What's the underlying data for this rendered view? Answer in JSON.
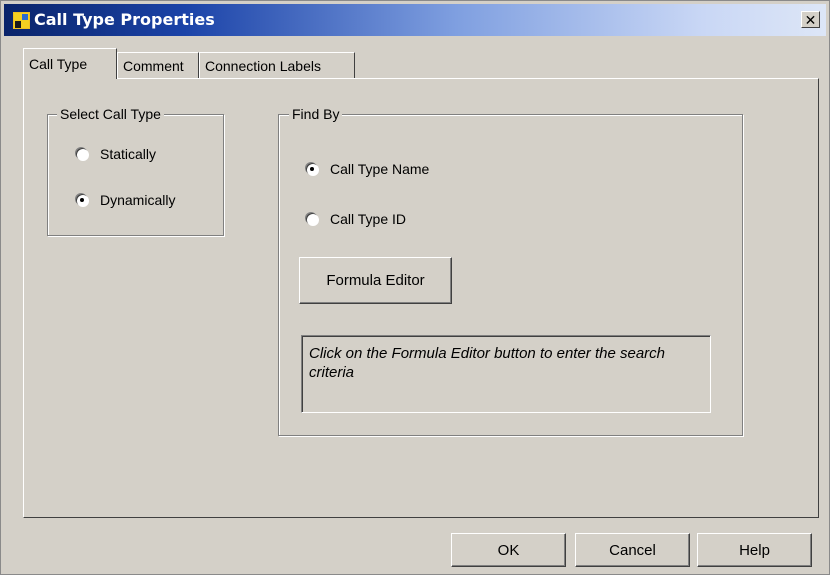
{
  "window": {
    "title": "Call Type Properties",
    "close_glyph": "✕",
    "icon": "app-window-icon"
  },
  "tabs": [
    {
      "label": "Call Type",
      "active": true
    },
    {
      "label": "Comment",
      "active": false
    },
    {
      "label": "Connection Labels",
      "active": false
    }
  ],
  "select_call_type": {
    "label": "Select Call Type",
    "options": [
      {
        "label": "Statically",
        "selected": false
      },
      {
        "label": "Dynamically",
        "selected": true
      }
    ]
  },
  "find_by": {
    "label": "Find By",
    "options": [
      {
        "label": "Call Type Name",
        "selected": true
      },
      {
        "label": "Call Type ID",
        "selected": false
      }
    ],
    "formula_button": "Formula Editor",
    "hint": "Click on the Formula Editor button to enter the search criteria"
  },
  "footer": {
    "ok": "OK",
    "cancel": "Cancel",
    "help": "Help"
  },
  "colors": {
    "face": "#d4d0c8",
    "title_start": "#0a246a",
    "title_end": "#dde6f7"
  }
}
